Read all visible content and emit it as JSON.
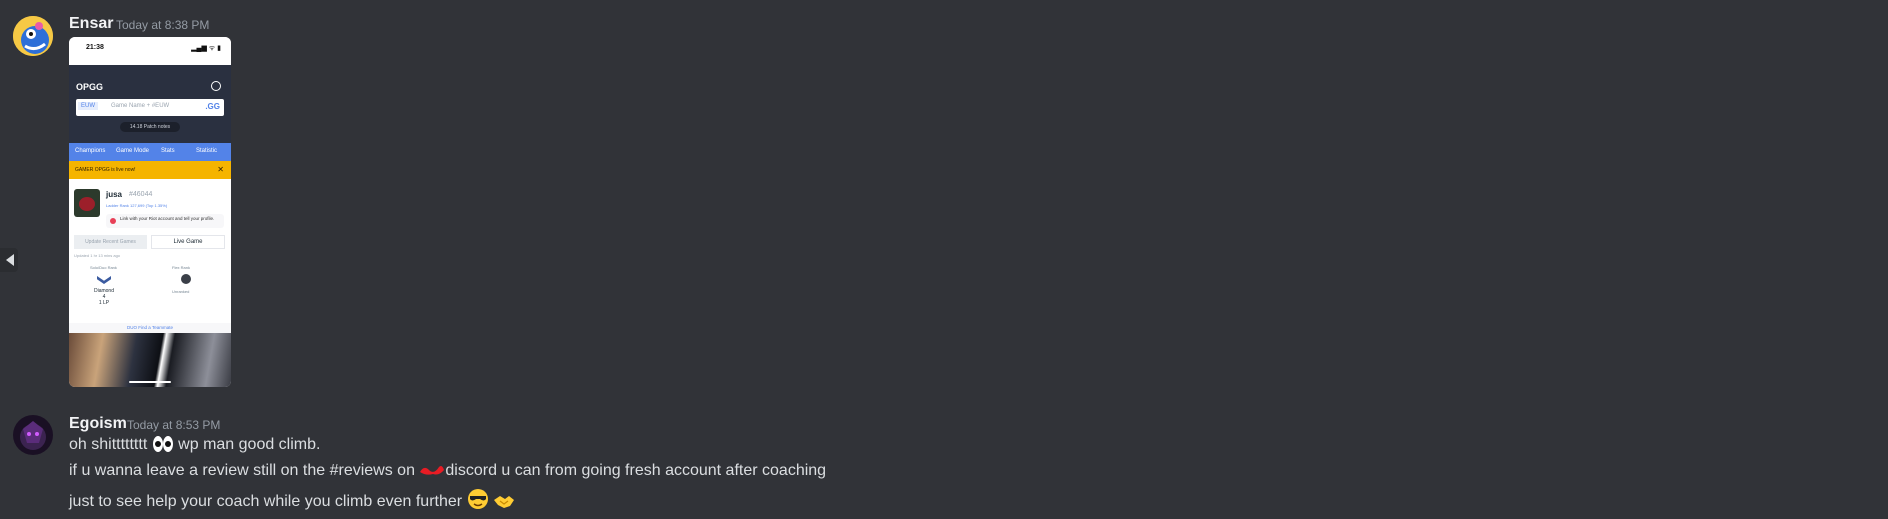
{
  "messages": [
    {
      "author": "Ensar",
      "timestamp": "Today at 8:38 PM",
      "attachment": {
        "status_time": "21:38",
        "status_icons": "▂▄▆ ᯤ ▮",
        "brand": "OPGG",
        "region": "EUW",
        "search_placeholder": "Game Name + #EUW",
        "search_suffix": ".GG",
        "patch": "14.18 Patch notes",
        "tabs": [
          "Champions",
          "Game Mode",
          "Stats",
          "Statistic"
        ],
        "banner": "GAMER OPGG is live now!",
        "banner_close": "✕",
        "profile_name": "jusa",
        "profile_tag": "#46044",
        "ladder": "Ladder Rank 127,699 (Top 1.35%)",
        "link_text": "Link with your Riot account and tell your profile.",
        "btn_update": "Update Recent Games",
        "btn_live": "Live Game",
        "updated": "Updated 1 hr 13 mins ago",
        "col_left": "Solo/Duo Rank",
        "col_right": "Flex Rank",
        "rank_left": "Diamond 4",
        "rank_left_lp": "1 LP",
        "rank_right": "Unranked",
        "duo_text": "DUO Find a Teammate"
      }
    },
    {
      "author": "Egoism",
      "timestamp": "Today at 8:53 PM",
      "lines": [
        {
          "text": "oh shitttttttt",
          "after": "wp man good climb."
        },
        {
          "before": "if u wanna leave a review still on the #reviews on ",
          "after": "discord u can from going fresh account after coaching"
        },
        {
          "text": "just to see help your coach while you climb even further"
        }
      ]
    }
  ],
  "colors": {
    "background": "#313338",
    "author": "#f2f3f5",
    "timestamp": "#949ba4",
    "text": "#dbdee1"
  },
  "icons": [
    "eyes-emoji",
    "sunglasses-emoji",
    "handshake-emoji",
    "collapse-arrow-icon"
  ]
}
